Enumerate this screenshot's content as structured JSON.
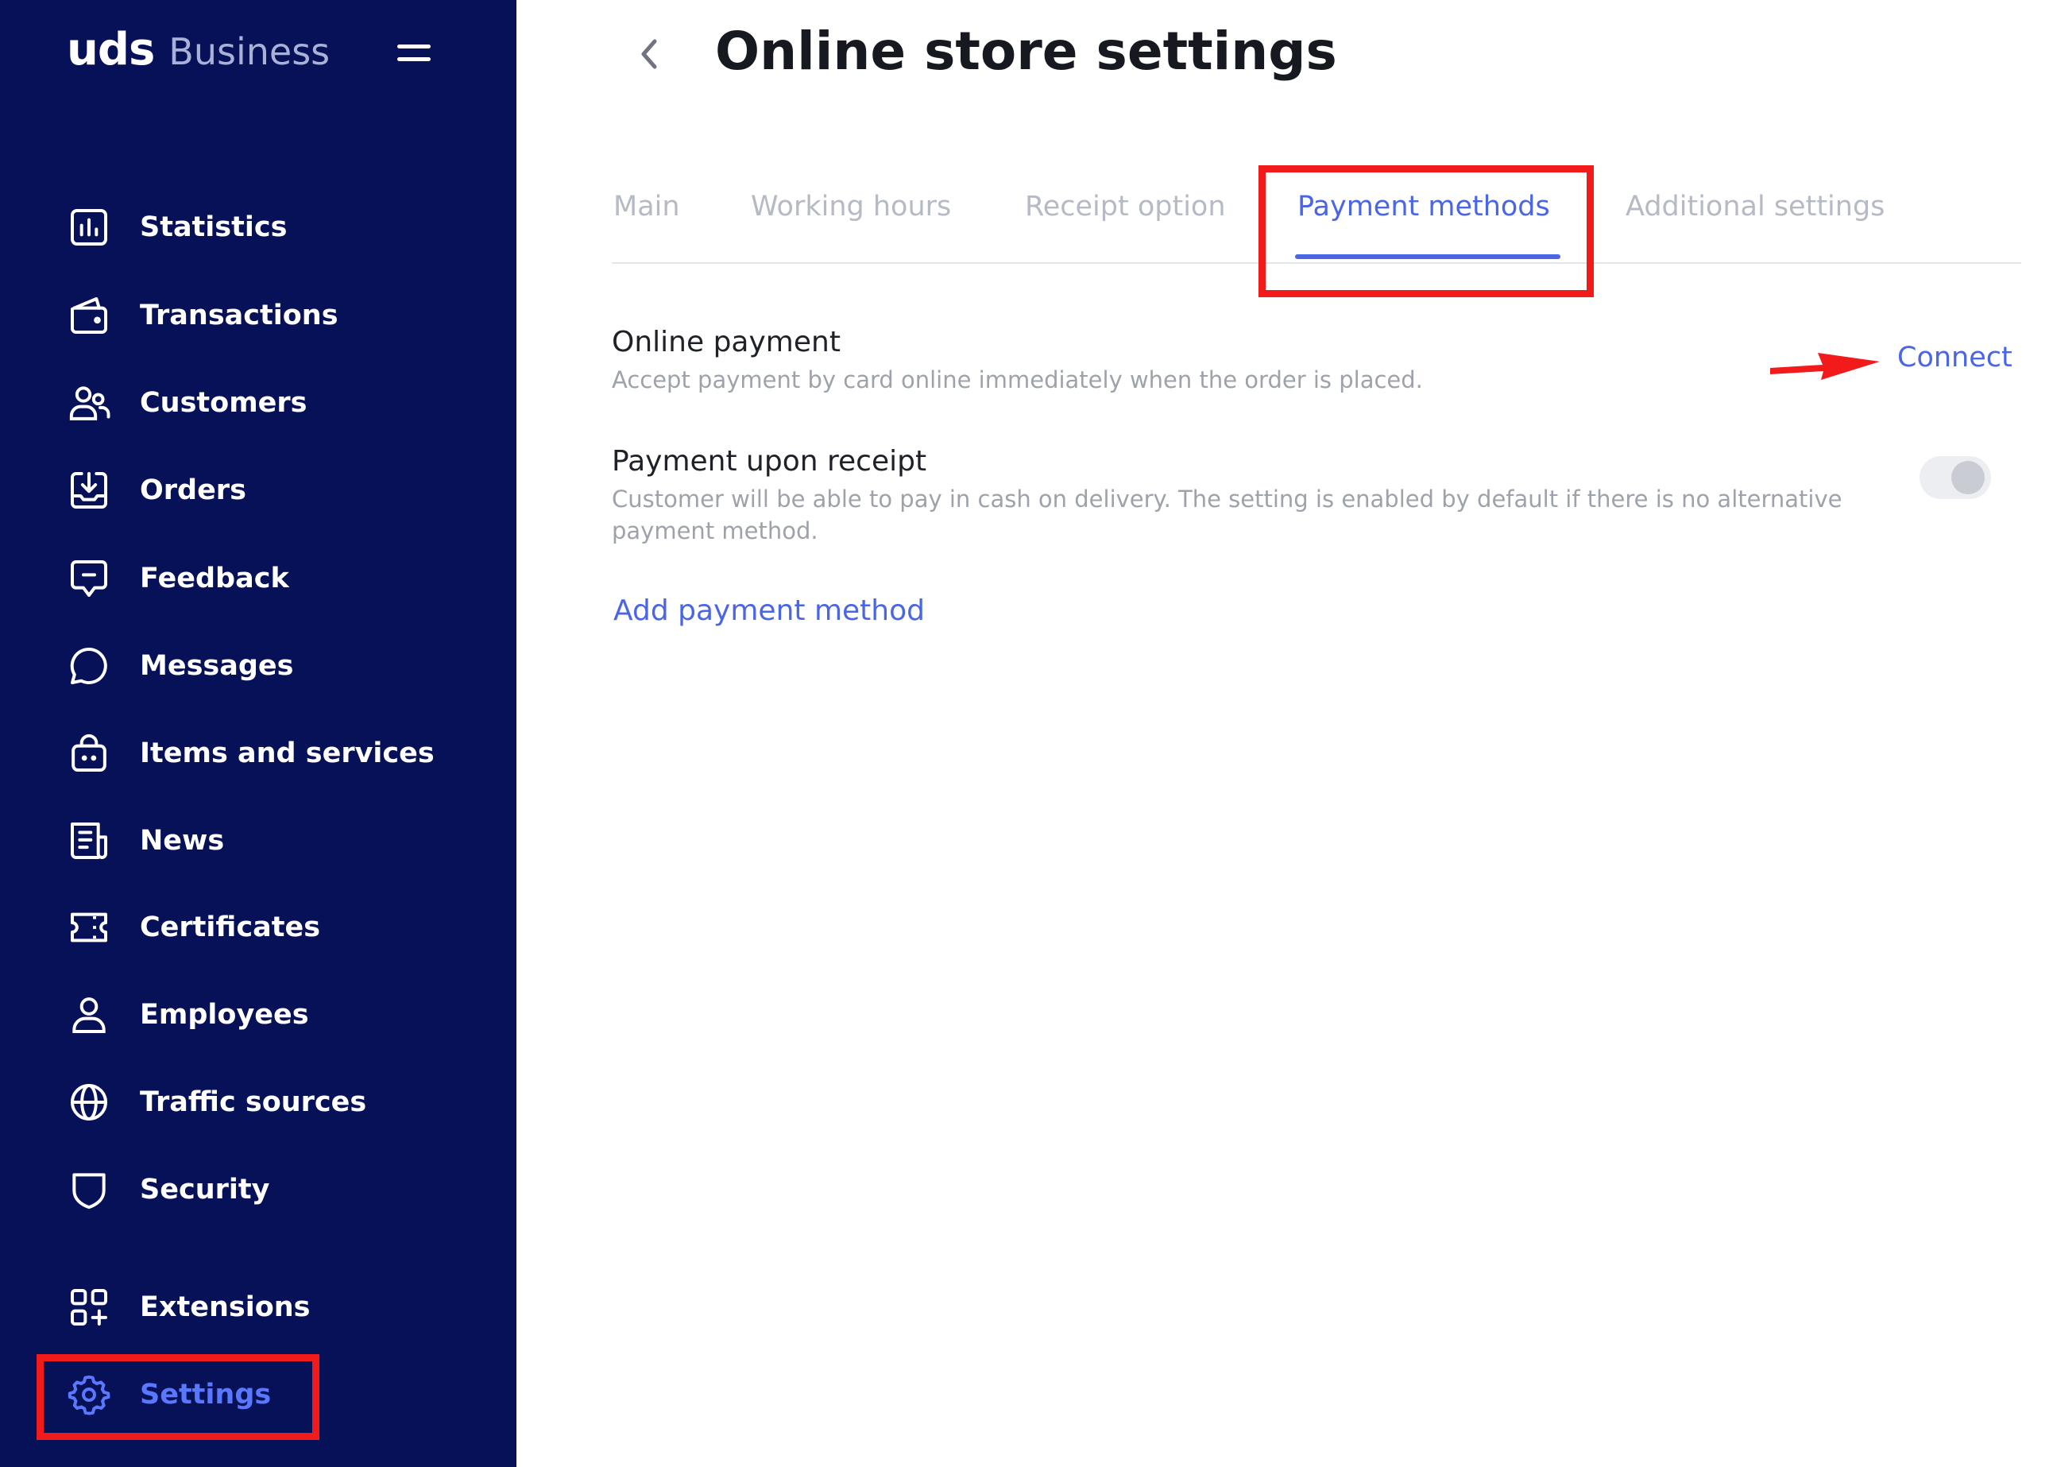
{
  "brand": {
    "logo_main": "uds",
    "logo_sub": "Business"
  },
  "sidebar": {
    "items": [
      {
        "label": "Statistics",
        "icon": "statistics-icon"
      },
      {
        "label": "Transactions",
        "icon": "wallet-icon"
      },
      {
        "label": "Customers",
        "icon": "users-icon"
      },
      {
        "label": "Orders",
        "icon": "inbox-download-icon"
      },
      {
        "label": "Feedback",
        "icon": "feedback-message-icon"
      },
      {
        "label": "Messages",
        "icon": "chat-bubble-icon"
      },
      {
        "label": "Items and services",
        "icon": "shopping-bag-icon"
      },
      {
        "label": "News",
        "icon": "newspaper-icon"
      },
      {
        "label": "Certificates",
        "icon": "ticket-icon"
      },
      {
        "label": "Employees",
        "icon": "person-icon"
      },
      {
        "label": "Traffic sources",
        "icon": "globe-icon"
      },
      {
        "label": "Security",
        "icon": "shield-icon"
      },
      {
        "label": "Extensions",
        "icon": "extensions-grid-icon"
      },
      {
        "label": "Settings",
        "icon": "gear-icon",
        "active": true
      }
    ]
  },
  "header": {
    "title": "Online store settings"
  },
  "tabs": [
    {
      "label": "Main"
    },
    {
      "label": "Working hours"
    },
    {
      "label": "Receipt option"
    },
    {
      "label": "Payment methods",
      "active": true
    },
    {
      "label": "Additional settings"
    }
  ],
  "payment": {
    "online": {
      "title": "Online payment",
      "description": "Accept payment by card online immediately when the order is placed.",
      "action": "Connect"
    },
    "on_receipt": {
      "title": "Payment upon receipt",
      "description": "Customer will be able to pay in cash on delivery. The setting is enabled by default if there is no alternative payment method.",
      "toggle_on": false
    },
    "add_label": "Add payment method"
  },
  "colors": {
    "sidebar_bg": "#061157",
    "accent": "#4a65e6",
    "highlight": "#f21b1b",
    "title_text": "#16191f"
  }
}
